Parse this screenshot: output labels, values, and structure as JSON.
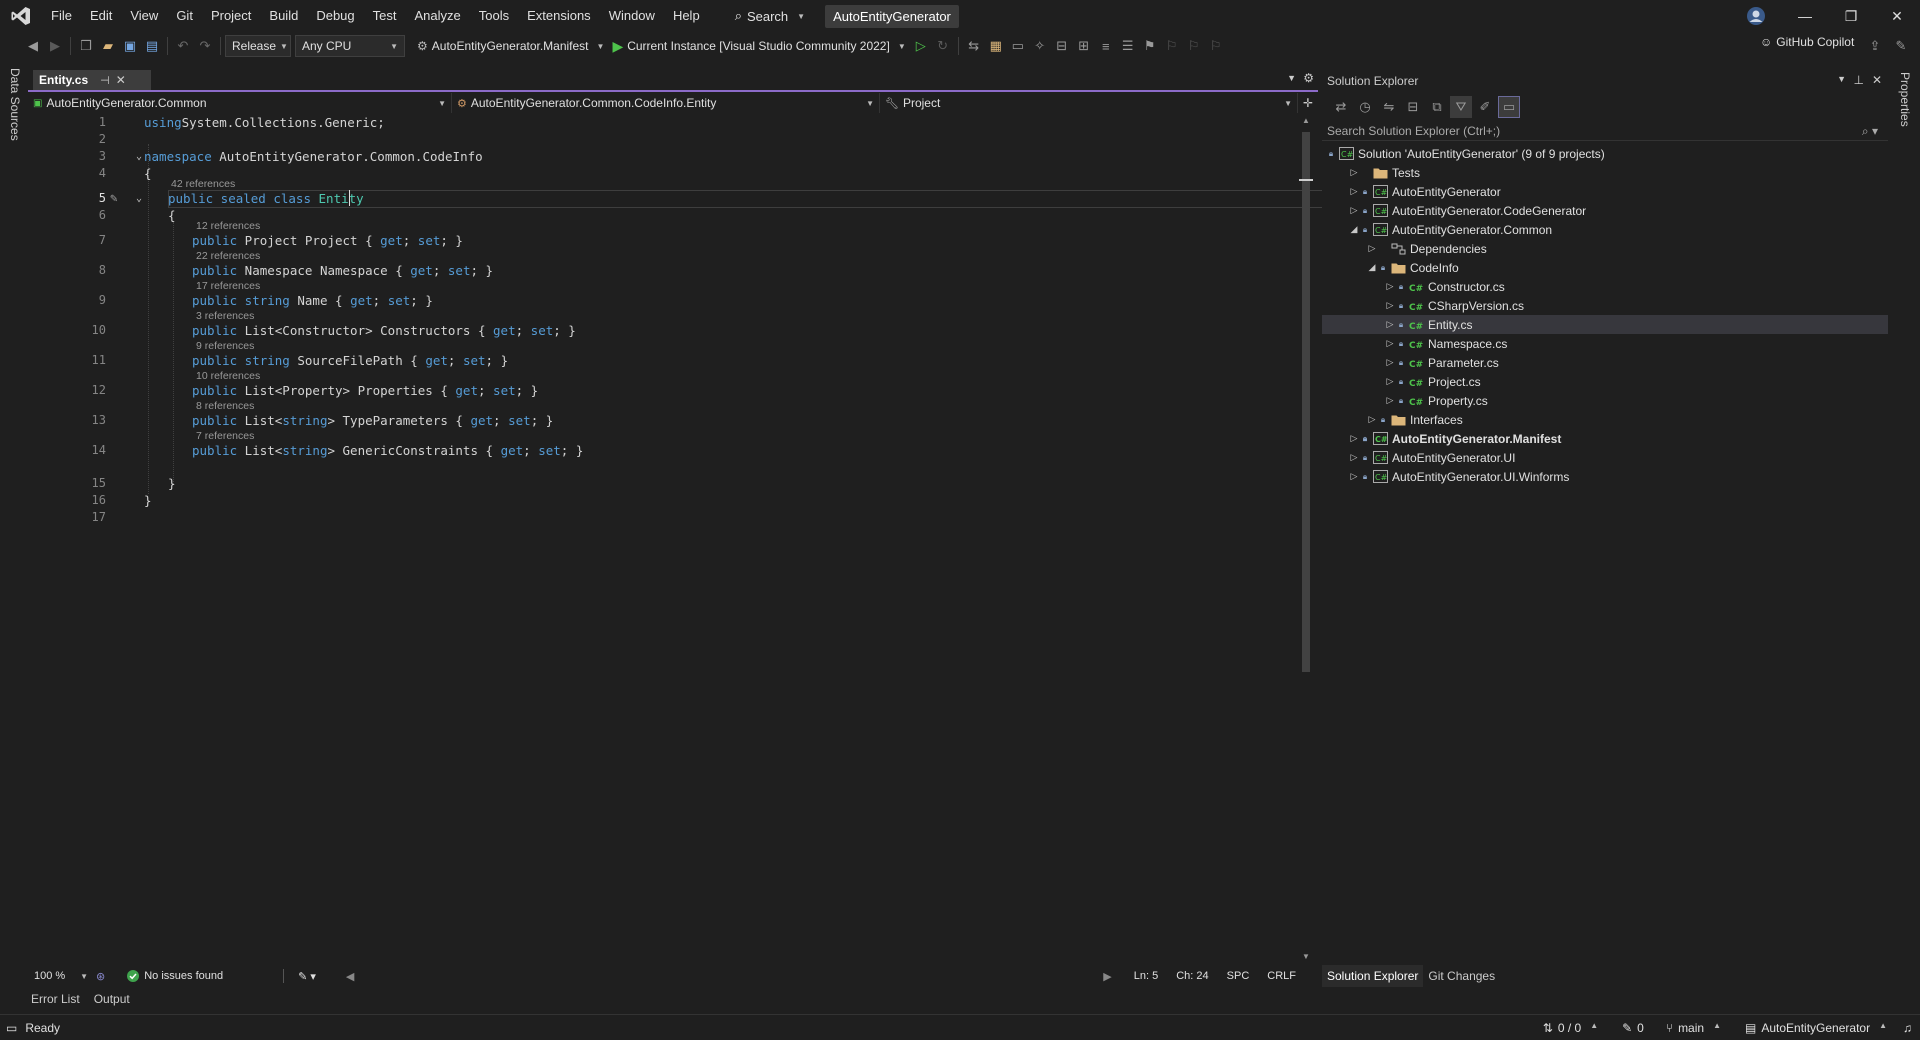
{
  "menubar": {
    "items": [
      "File",
      "Edit",
      "View",
      "Git",
      "Project",
      "Build",
      "Debug",
      "Test",
      "Analyze",
      "Tools",
      "Extensions",
      "Window",
      "Help"
    ],
    "search_label": "Search",
    "solution_name": "AutoEntityGenerator"
  },
  "toolbar": {
    "configuration": "Release",
    "platform": "Any CPU",
    "startup_project": "AutoEntityGenerator.Manifest",
    "run_target": "Current Instance [Visual Studio Community 2022]",
    "copilot_label": "GitHub Copilot"
  },
  "left_strip": {
    "label": "Data Sources"
  },
  "right_strip": {
    "label": "Properties"
  },
  "editor": {
    "tab_label": "Entity.cs",
    "nav_project": "AutoEntityGenerator.Common",
    "nav_type": "AutoEntityGenerator.Common.CodeInfo.Entity",
    "nav_member": "Project",
    "lines": [
      {
        "n": "1",
        "lens": "",
        "code": [
          [
            "kw",
            "using"
          ],
          [
            "",
            "System.Collections.Generic;"
          ]
        ]
      },
      {
        "n": "2",
        "lens": "",
        "code": []
      },
      {
        "n": "3",
        "lens": "",
        "code": [
          [
            "kw",
            "namespace"
          ],
          [
            "",
            " AutoEntityGenerator.Common.CodeInfo"
          ]
        ]
      },
      {
        "n": "4",
        "lens": "",
        "code": [
          [
            "",
            "{"
          ]
        ]
      },
      {
        "n": "5",
        "lens": "42 references",
        "code": [
          [
            "kw",
            "public sealed class"
          ],
          [
            "",
            " "
          ],
          [
            "ty",
            "Entity"
          ]
        ]
      },
      {
        "n": "6",
        "lens": "",
        "code": [
          [
            "",
            "{"
          ]
        ]
      },
      {
        "n": "7",
        "lens": "12 references",
        "code": [
          [
            "kw",
            "public"
          ],
          [
            "",
            " Project Project { "
          ],
          [
            "kw",
            "get"
          ],
          [
            "",
            "; "
          ],
          [
            "kw",
            "set"
          ],
          [
            "",
            "; }"
          ]
        ]
      },
      {
        "n": "8",
        "lens": "22 references",
        "code": [
          [
            "kw",
            "public"
          ],
          [
            "",
            " Namespace Namespace { "
          ],
          [
            "kw",
            "get"
          ],
          [
            "",
            "; "
          ],
          [
            "kw",
            "set"
          ],
          [
            "",
            "; }"
          ]
        ]
      },
      {
        "n": "9",
        "lens": "17 references",
        "code": [
          [
            "kw",
            "public string"
          ],
          [
            "",
            " Name { "
          ],
          [
            "kw",
            "get"
          ],
          [
            "",
            "; "
          ],
          [
            "kw",
            "set"
          ],
          [
            "",
            "; }"
          ]
        ]
      },
      {
        "n": "10",
        "lens": "3 references",
        "code": [
          [
            "kw",
            "public"
          ],
          [
            "",
            " List<Constructor> Constructors { "
          ],
          [
            "kw",
            "get"
          ],
          [
            "",
            "; "
          ],
          [
            "kw",
            "set"
          ],
          [
            "",
            "; }"
          ]
        ]
      },
      {
        "n": "11",
        "lens": "9 references",
        "code": [
          [
            "kw",
            "public string"
          ],
          [
            "",
            " SourceFilePath { "
          ],
          [
            "kw",
            "get"
          ],
          [
            "",
            "; "
          ],
          [
            "kw",
            "set"
          ],
          [
            "",
            "; }"
          ]
        ]
      },
      {
        "n": "12",
        "lens": "10 references",
        "code": [
          [
            "kw",
            "public"
          ],
          [
            "",
            " List<Property> Properties { "
          ],
          [
            "kw",
            "get"
          ],
          [
            "",
            "; "
          ],
          [
            "kw",
            "set"
          ],
          [
            "",
            "; }"
          ]
        ]
      },
      {
        "n": "13",
        "lens": "8 references",
        "code": [
          [
            "kw",
            "public"
          ],
          [
            "",
            " List<"
          ],
          [
            "kw",
            "string"
          ],
          [
            "",
            "> TypeParameters { "
          ],
          [
            "kw",
            "get"
          ],
          [
            "",
            "; "
          ],
          [
            "kw",
            "set"
          ],
          [
            "",
            "; }"
          ]
        ]
      },
      {
        "n": "14",
        "lens": "7 references",
        "code": [
          [
            "kw",
            "public"
          ],
          [
            "",
            " List<"
          ],
          [
            "kw",
            "string"
          ],
          [
            "",
            "> GenericConstraints { "
          ],
          [
            "kw",
            "get"
          ],
          [
            "",
            "; "
          ],
          [
            "kw",
            "set"
          ],
          [
            "",
            "; }"
          ]
        ]
      },
      {
        "n": "15",
        "lens": "",
        "code": [
          [
            "",
            "}"
          ]
        ]
      },
      {
        "n": "16",
        "lens": "",
        "code": [
          [
            "",
            "}"
          ]
        ]
      },
      {
        "n": "17",
        "lens": "",
        "code": []
      }
    ],
    "status": {
      "zoom": "100 %",
      "issues": "No issues found",
      "line": "Ln: 5",
      "char": "Ch: 24",
      "spacing": "SPC",
      "eol": "CRLF"
    }
  },
  "bottom_tabs": [
    "Error List",
    "Output"
  ],
  "solution_explorer": {
    "title": "Solution Explorer",
    "search_placeholder": "Search Solution Explorer (Ctrl+;)",
    "tree": [
      {
        "label": "Solution 'AutoEntityGenerator' (9 of 9 projects)",
        "icon": "solution"
      },
      {
        "label": "Tests",
        "icon": "folder"
      },
      {
        "label": "AutoEntityGenerator",
        "icon": "project"
      },
      {
        "label": "AutoEntityGenerator.CodeGenerator",
        "icon": "project"
      },
      {
        "label": "AutoEntityGenerator.Common",
        "icon": "project"
      },
      {
        "label": "Dependencies",
        "icon": "dependencies"
      },
      {
        "label": "CodeInfo",
        "icon": "folder"
      },
      {
        "label": "Constructor.cs",
        "icon": "csharp-file"
      },
      {
        "label": "CSharpVersion.cs",
        "icon": "csharp-file"
      },
      {
        "label": "Entity.cs",
        "icon": "csharp-file"
      },
      {
        "label": "Namespace.cs",
        "icon": "csharp-file"
      },
      {
        "label": "Parameter.cs",
        "icon": "csharp-file"
      },
      {
        "label": "Project.cs",
        "icon": "csharp-file"
      },
      {
        "label": "Property.cs",
        "icon": "csharp-file"
      },
      {
        "label": "Interfaces",
        "icon": "folder"
      },
      {
        "label": "AutoEntityGenerator.Manifest",
        "icon": "project"
      },
      {
        "label": "AutoEntityGenerator.UI",
        "icon": "project"
      },
      {
        "label": "AutoEntityGenerator.UI.Winforms",
        "icon": "project"
      }
    ],
    "tabs": [
      "Solution Explorer",
      "Git Changes"
    ]
  },
  "statusbar": {
    "ready": "Ready",
    "sync": "0 / 0",
    "pending": "0",
    "branch": "main",
    "repo": "AutoEntityGenerator"
  },
  "colors": {
    "accent": "#8c6bc8",
    "keyword": "#569cd6",
    "type": "#4ec9b0",
    "run_green": "#4ec34b"
  }
}
